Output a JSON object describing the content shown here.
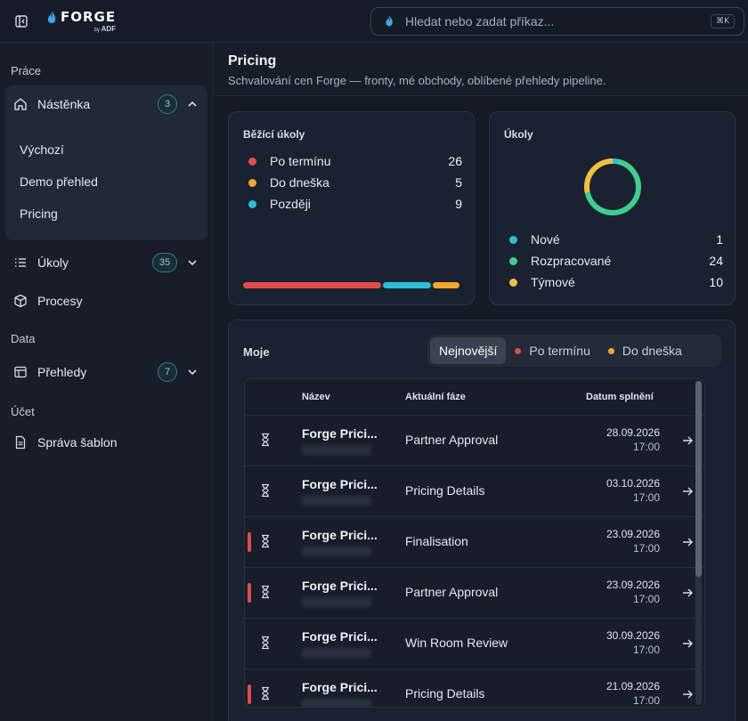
{
  "app": {
    "logo_word": "FORGE",
    "logo_by": "by",
    "logo_sub": "ADF"
  },
  "search": {
    "placeholder": "Hledat nebo zadat příkaz...",
    "shortcut": "⌘K"
  },
  "sidebar": {
    "sections": {
      "work": "Práce",
      "data": "Data",
      "account": "Účet"
    },
    "items": [
      {
        "label": "Nástěnka",
        "icon": "home-icon",
        "badge": "3",
        "expanded": true
      },
      {
        "label": "Úkoly",
        "icon": "list-icon",
        "badge": "35",
        "expanded": false
      },
      {
        "label": "Procesy",
        "icon": "cube-icon"
      },
      {
        "label": "Přehledy",
        "icon": "table-icon",
        "badge": "7",
        "expanded": false
      },
      {
        "label": "Správa šablon",
        "icon": "document-icon"
      }
    ],
    "subitems": [
      "Výchozí",
      "Demo přehled",
      "Pricing"
    ]
  },
  "page": {
    "title": "Pricing",
    "subtitle": "Schvalování cen Forge — fronty, mé obchody, oblíbené přehledy pipeline."
  },
  "running_tasks": {
    "title": "Běžící úkoly",
    "rows": [
      {
        "label": "Po termínu",
        "value": "26",
        "color": "#e34b4b"
      },
      {
        "label": "Do dneška",
        "value": "5",
        "color": "#f0a92a"
      },
      {
        "label": "Později",
        "value": "9",
        "color": "#2bbfd6"
      }
    ],
    "bar": [
      {
        "value": 26,
        "color": "#e34b4b"
      },
      {
        "value": 9,
        "color": "#2bbfd6"
      },
      {
        "value": 5,
        "color": "#f0a92a"
      }
    ]
  },
  "tasks": {
    "title": "Úkoly",
    "rows": [
      {
        "label": "Nové",
        "value": "1",
        "color": "#2bbfd6"
      },
      {
        "label": "Rozpracované",
        "value": "24",
        "color": "#3ecf8e"
      },
      {
        "label": "Týmové",
        "value": "10",
        "color": "#f0c040"
      }
    ]
  },
  "moje": {
    "title": "Moje",
    "filters": [
      {
        "label": "Nejnovější",
        "active": true
      },
      {
        "label": "Po termínu",
        "color": "#e34b4b"
      },
      {
        "label": "Do dneška",
        "color": "#f0a92a"
      }
    ],
    "columns": [
      "Název",
      "Aktuální fáze",
      "Datum splnění"
    ],
    "rows": [
      {
        "name": "Forge Prici...",
        "phase": "Partner Approval",
        "date": "28.09.2026",
        "time": "17:00",
        "overdue": false
      },
      {
        "name": "Forge Prici...",
        "phase": "Pricing Details",
        "date": "03.10.2026",
        "time": "17:00",
        "overdue": false
      },
      {
        "name": "Forge Prici...",
        "phase": "Finalisation",
        "date": "23.09.2026",
        "time": "17:00",
        "overdue": true
      },
      {
        "name": "Forge Prici...",
        "phase": "Partner Approval",
        "date": "23.09.2026",
        "time": "17:00",
        "overdue": true
      },
      {
        "name": "Forge Prici...",
        "phase": "Win Room Review",
        "date": "30.09.2026",
        "time": "17:00",
        "overdue": false
      },
      {
        "name": "Forge Prici...",
        "phase": "Pricing Details",
        "date": "21.09.2026",
        "time": "17:00",
        "overdue": true
      }
    ]
  }
}
